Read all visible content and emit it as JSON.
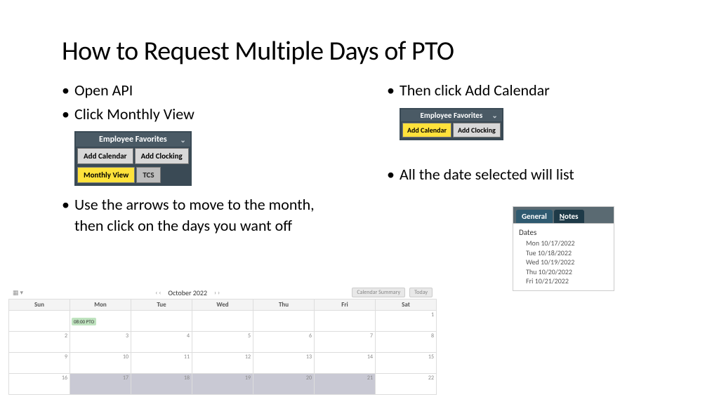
{
  "title": "How to Request Multiple Days of PTO",
  "left_bullets": {
    "b1": "Open API",
    "b2": "Click Monthly View",
    "b3": "Use the arrows to move to the month, then click on the days you want off"
  },
  "right_bullets": {
    "b1": "Then click Add Calendar",
    "b2": "All the date selected will list"
  },
  "widget1": {
    "header": "Employee Favorites",
    "btns": {
      "add_cal": "Add Calendar",
      "add_clock": "Add Clocking",
      "monthly": "Monthly View",
      "tcs": "TCS"
    }
  },
  "widget2": {
    "header": "Employee Favorites",
    "btns": {
      "add_cal": "Add Calendar",
      "add_clock": "Add Clocking"
    }
  },
  "calendar": {
    "month_label": "October 2022",
    "summary_btn": "Calendar Summary",
    "today_btn": "Today",
    "days": [
      "Sun",
      "Mon",
      "Tue",
      "Wed",
      "Thu",
      "Fri",
      "Sat"
    ],
    "event_label": "08:00 PTO",
    "row1": [
      "",
      "",
      "",
      "",
      "",
      "",
      "1"
    ],
    "row2": [
      "2",
      "3",
      "4",
      "5",
      "6",
      "7",
      "8"
    ],
    "row3": [
      "9",
      "10",
      "11",
      "12",
      "13",
      "14",
      "15"
    ],
    "row4": [
      "16",
      "17",
      "18",
      "19",
      "20",
      "21",
      "22"
    ],
    "selected": [
      17,
      18,
      19,
      20,
      21
    ]
  },
  "dates_panel": {
    "tab1": "General",
    "tab2_pre": "N",
    "tab2_rest": "otes",
    "label": "Dates",
    "lines": [
      "Mon 10/17/2022",
      "Tue 10/18/2022",
      "Wed 10/19/2022",
      "Thu 10/20/2022",
      "Fri 10/21/2022"
    ]
  }
}
